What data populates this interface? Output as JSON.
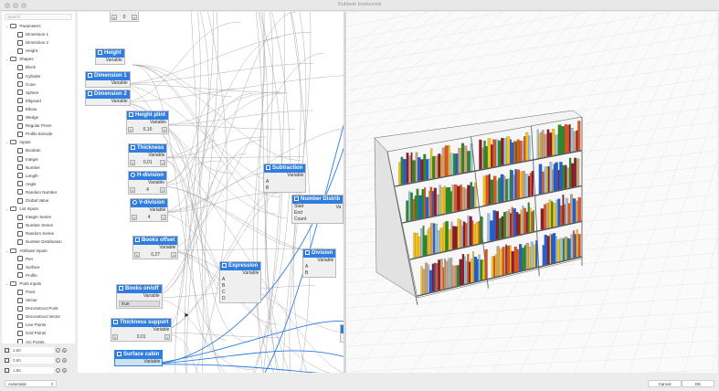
{
  "window": {
    "title": "Dubbele boekenrek"
  },
  "sidebar": {
    "search_placeholder": "Search",
    "categories": [
      {
        "label": "Parameters",
        "items": [
          "Dimension 1",
          "Dimension 2",
          "Height"
        ]
      },
      {
        "label": "Shapes",
        "items": [
          "Block",
          "Cylinder",
          "Cone",
          "Sphere",
          "Ellipsoid",
          "Elbow",
          "Wedge",
          "Regular Prism",
          "Profile Extrude"
        ]
      },
      {
        "label": "Inputs",
        "items": [
          "Boolean",
          "Integer",
          "Number",
          "Length",
          "Angle",
          "Random Number",
          "Global Value"
        ]
      },
      {
        "label": "List Inputs",
        "items": [
          "Integer Series",
          "Number Series",
          "Random Series",
          "Number Distribution"
        ]
      },
      {
        "label": "Attribute Inputs",
        "items": [
          "Pen",
          "Surface",
          "Profile"
        ]
      },
      {
        "label": "Point Inputs",
        "items": [
          "Point",
          "Vector",
          "Deconstruct Point",
          "Deconstruct Vector",
          "Line Points",
          "Grid Points",
          "Arc Points"
        ]
      }
    ],
    "fields": [
      {
        "value": "2,50"
      },
      {
        "value": "0,60"
      },
      {
        "value": "1,85"
      }
    ]
  },
  "graph": {
    "output_label": "Variable",
    "nodes": {
      "top": {
        "value": "0"
      },
      "height": {
        "title": "Height"
      },
      "dim1": {
        "title": "Dimension 1"
      },
      "dim2": {
        "title": "Dimension 2"
      },
      "plint": {
        "title": "Height plint",
        "value": "0,10"
      },
      "thick": {
        "title": "Thickness",
        "value": "0,01"
      },
      "hdiv": {
        "title": "H-division",
        "value": "4"
      },
      "vdiv": {
        "title": "V-division",
        "value": "4"
      },
      "offset": {
        "title": "Books offset",
        "value": "0,27"
      },
      "onoff": {
        "title": "Books on/off",
        "value": "true"
      },
      "support": {
        "title": "Thickness support",
        "value": "0,01"
      },
      "surface": {
        "title": "Surface cabin"
      },
      "expression": {
        "title": "Expression",
        "inputs": [
          "A",
          "B",
          "C",
          "D"
        ]
      },
      "subtraction": {
        "title": "Subtraction",
        "inputs": [
          "A",
          "B"
        ]
      },
      "numdist": {
        "title": "Number Distrib",
        "inputs": [
          "Start",
          "End",
          "Count"
        ],
        "out": "Va"
      },
      "division": {
        "title": "Division",
        "inputs": [
          "A",
          "B"
        ]
      }
    }
  },
  "bottom": {
    "mode": "Automatic",
    "cancel": "Cancel",
    "ok": "OK"
  },
  "colors": {
    "accent": "#2f7de1",
    "wire": "#9a9a9a",
    "books": [
      "#e2541b",
      "#2a8a2a",
      "#1f5fd6",
      "#9bc1d8",
      "#c9a27a",
      "#8c1a2b",
      "#f2c21b"
    ]
  }
}
